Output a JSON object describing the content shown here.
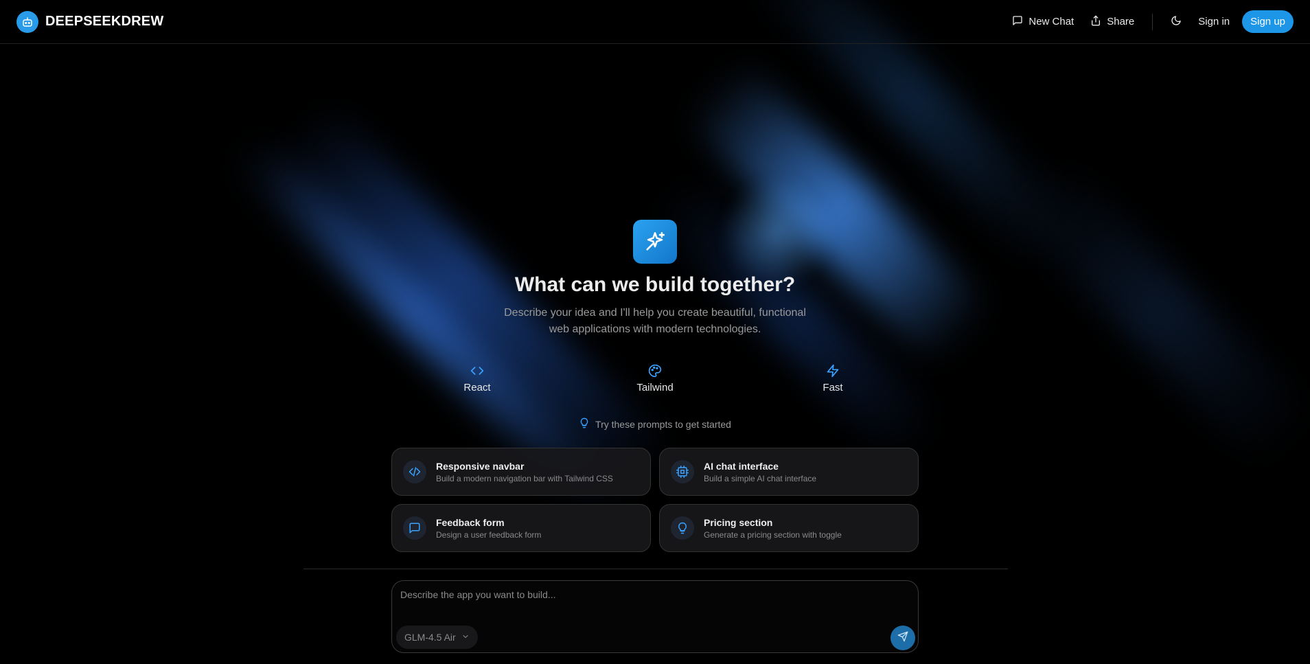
{
  "app": {
    "name": "DEEPSEEKDREW"
  },
  "header": {
    "new_chat": "New Chat",
    "share": "Share",
    "sign_in": "Sign in",
    "sign_up": "Sign up"
  },
  "hero": {
    "title": "What can we build together?",
    "subtitle": "Describe your idea and I'll help you create beautiful, functional web applications with modern technologies."
  },
  "tech": [
    {
      "label": "React",
      "icon": "code-icon"
    },
    {
      "label": "Tailwind",
      "icon": "palette-icon"
    },
    {
      "label": "Fast",
      "icon": "lightning-icon"
    }
  ],
  "hint": "Try these prompts to get started",
  "prompts": [
    {
      "title": "Responsive navbar",
      "desc": "Build a modern navigation bar with Tailwind CSS",
      "icon": "code-icon"
    },
    {
      "title": "AI chat interface",
      "desc": "Build a simple AI chat interface",
      "icon": "cpu-icon"
    },
    {
      "title": "Feedback form",
      "desc": "Design a user feedback form",
      "icon": "message-icon"
    },
    {
      "title": "Pricing section",
      "desc": "Generate a pricing section with toggle",
      "icon": "lightbulb-icon"
    }
  ],
  "composer": {
    "placeholder": "Describe the app you want to build...",
    "model": "GLM-4.5 Air"
  },
  "colors": {
    "accent": "#1e96e8",
    "background": "#000000"
  }
}
